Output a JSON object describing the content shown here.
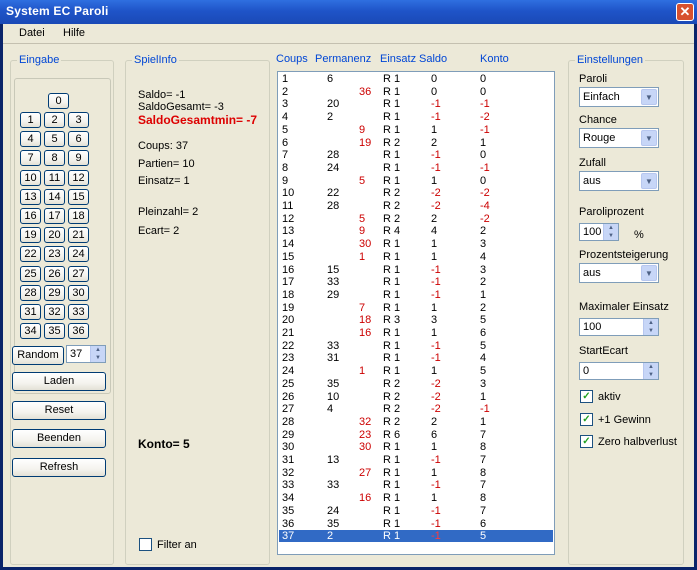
{
  "window": {
    "title": "System EC Paroli",
    "close_glyph": "✕"
  },
  "menu": [
    "Datei",
    "Hilfe"
  ],
  "eingabe": {
    "title": "Eingabe",
    "zero": "0",
    "grid": [
      [
        "1",
        "2",
        "3"
      ],
      [
        "4",
        "5",
        "6"
      ],
      [
        "7",
        "8",
        "9"
      ],
      [
        "10",
        "11",
        "12"
      ],
      [
        "13",
        "14",
        "15"
      ],
      [
        "16",
        "17",
        "18"
      ],
      [
        "19",
        "20",
        "21"
      ],
      [
        "22",
        "23",
        "24"
      ],
      [
        "25",
        "26",
        "27"
      ],
      [
        "28",
        "29",
        "30"
      ],
      [
        "31",
        "32",
        "33"
      ],
      [
        "34",
        "35",
        "36"
      ]
    ],
    "random_label": "Random",
    "random_value": "37",
    "buttons": [
      "Laden",
      "Reset",
      "Beenden",
      "Refresh"
    ]
  },
  "spielinfo": {
    "title": "SpielInfo",
    "saldo": "Saldo= -1",
    "saldo_gesamt": "SaldoGesamt= -3",
    "saldo_gesamt_min": "SaldoGesamtmin= -7",
    "coups": "Coups: 37",
    "partien": "Partien= 10",
    "einsatz": "Einsatz= 1",
    "pleinzahl": "Pleinzahl= 2",
    "ecart": "Ecart= 2",
    "konto": "Konto= 5",
    "filter_label": "Filter an"
  },
  "list": {
    "headers": [
      "Coups",
      "Permanenz",
      "Einsatz",
      "Saldo",
      "Konto"
    ],
    "rows": [
      [
        "1",
        "6",
        "",
        "R 1",
        "0",
        "0"
      ],
      [
        "2",
        "",
        "36",
        "R 1",
        "0",
        "0"
      ],
      [
        "3",
        "20",
        "",
        "R 1",
        "-1",
        "-1"
      ],
      [
        "4",
        "2",
        "",
        "R 1",
        "-1",
        "-2"
      ],
      [
        "5",
        "",
        "9",
        "R 1",
        "1",
        "-1"
      ],
      [
        "6",
        "",
        "19",
        "R 2",
        "2",
        "1"
      ],
      [
        "7",
        "28",
        "",
        "R 1",
        "-1",
        "0"
      ],
      [
        "8",
        "24",
        "",
        "R 1",
        "-1",
        "-1"
      ],
      [
        "9",
        "",
        "5",
        "R 1",
        "1",
        "0"
      ],
      [
        "10",
        "22",
        "",
        "R 2",
        "-2",
        "-2"
      ],
      [
        "11",
        "28",
        "",
        "R 2",
        "-2",
        "-4"
      ],
      [
        "12",
        "",
        "5",
        "R 2",
        "2",
        "-2"
      ],
      [
        "13",
        "",
        "9",
        "R 4",
        "4",
        "2"
      ],
      [
        "14",
        "",
        "30",
        "R 1",
        "1",
        "3"
      ],
      [
        "15",
        "",
        "1",
        "R 1",
        "1",
        "4"
      ],
      [
        "16",
        "15",
        "",
        "R 1",
        "-1",
        "3"
      ],
      [
        "17",
        "33",
        "",
        "R 1",
        "-1",
        "2"
      ],
      [
        "18",
        "29",
        "",
        "R 1",
        "-1",
        "1"
      ],
      [
        "19",
        "",
        "7",
        "R 1",
        "1",
        "2"
      ],
      [
        "20",
        "",
        "18",
        "R 3",
        "3",
        "5"
      ],
      [
        "21",
        "",
        "16",
        "R 1",
        "1",
        "6"
      ],
      [
        "22",
        "33",
        "",
        "R 1",
        "-1",
        "5"
      ],
      [
        "23",
        "31",
        "",
        "R 1",
        "-1",
        "4"
      ],
      [
        "24",
        "",
        "1",
        "R 1",
        "1",
        "5"
      ],
      [
        "25",
        "35",
        "",
        "R 2",
        "-2",
        "3"
      ],
      [
        "26",
        "10",
        "",
        "R 2",
        "-2",
        "1"
      ],
      [
        "27",
        "4",
        "",
        "R 2",
        "-2",
        "-1"
      ],
      [
        "28",
        "",
        "32",
        "R 2",
        "2",
        "1"
      ],
      [
        "29",
        "",
        "23",
        "R 6",
        "6",
        "7"
      ],
      [
        "30",
        "",
        "30",
        "R 1",
        "1",
        "8"
      ],
      [
        "31",
        "13",
        "",
        "R 1",
        "-1",
        "7"
      ],
      [
        "32",
        "",
        "27",
        "R 1",
        "1",
        "8"
      ],
      [
        "33",
        "33",
        "",
        "R 1",
        "-1",
        "7"
      ],
      [
        "34",
        "",
        "16",
        "R 1",
        "1",
        "8"
      ],
      [
        "35",
        "24",
        "",
        "R 1",
        "-1",
        "7"
      ],
      [
        "36",
        "35",
        "",
        "R 1",
        "-1",
        "6"
      ],
      [
        "37",
        "2",
        "",
        "R 1",
        "-1",
        "5"
      ]
    ],
    "selected_index": 36
  },
  "einstellungen": {
    "title": "Einstellungen",
    "paroli_label": "Paroli",
    "paroli_value": "Einfach",
    "chance_label": "Chance",
    "chance_value": "Rouge",
    "zufall_label": "Zufall",
    "zufall_value": "aus",
    "paroliprozent_label": "Paroliprozent",
    "paroliprozent_value": "100",
    "percent_sign": "%",
    "prozentsteigerung_label": "Prozentsteigerung",
    "prozentsteigerung_value": "aus",
    "max_einsatz_label": "Maximaler Einsatz",
    "max_einsatz_value": "100",
    "startecart_label": "StartEcart",
    "startecart_value": "0",
    "checkboxes": [
      "aktiv",
      "+1 Gewinn",
      "Zero halbverlust"
    ]
  }
}
